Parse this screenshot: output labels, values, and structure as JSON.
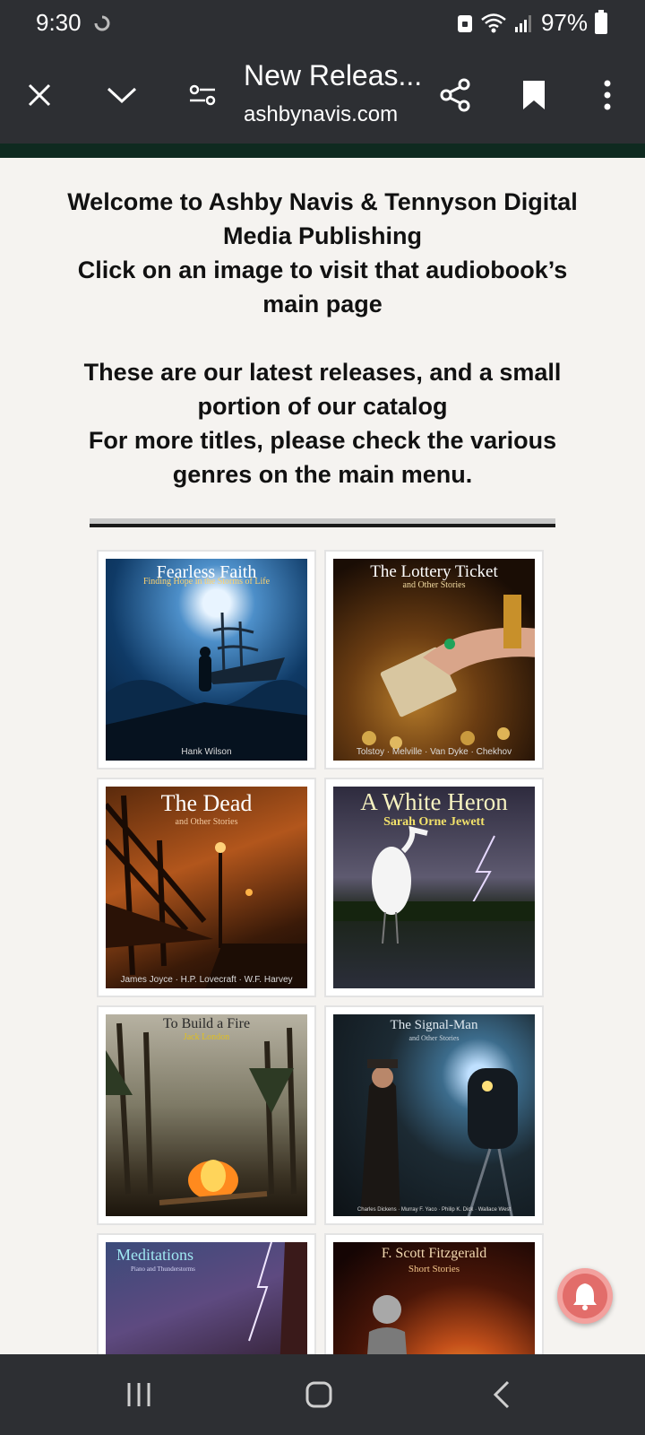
{
  "status": {
    "time": "9:30",
    "battery": "97%"
  },
  "toolbar": {
    "title": "New Releas...",
    "url": "ashbynavis.com"
  },
  "intro": {
    "line1": "Welcome to Ashby Navis & Tennyson Digital Media Publishing",
    "line2": "Click on an image to visit that audiobook’s main page",
    "line3": "These are our latest releases, and a small portion of our catalog",
    "line4": "For more titles, please check the various genres on the main menu."
  },
  "books": [
    {
      "title": "Fearless Faith",
      "subtitle": "Finding Hope in the Storms of Life",
      "author": "Hank Wilson"
    },
    {
      "title": "The Lottery Ticket",
      "subtitle": "and Other Stories",
      "author": "Tolstoy · Melville · Van Dyke · Chekhov"
    },
    {
      "title": "The Dead",
      "subtitle": "and Other Stories",
      "author": "James Joyce · H.P. Lovecraft · W.F. Harvey"
    },
    {
      "title": "A White Heron",
      "subtitle": "Sarah Orne Jewett",
      "author": ""
    },
    {
      "title": "To Build a Fire",
      "subtitle": "Jack London",
      "author": ""
    },
    {
      "title": "The Signal-Man",
      "subtitle": "and Other Stories",
      "author": "Charles Dickens · Murray F. Yaco · Philip K. Dick · Wallace West"
    },
    {
      "title": "Meditations",
      "subtitle": "Piano and Thunderstorms",
      "author": ""
    },
    {
      "title": "F. Scott Fitzgerald",
      "subtitle": "Short Stories",
      "author": ""
    }
  ],
  "colors": {
    "bar": "#2d2f33",
    "accent": "#0f2a20",
    "page": "#f5f3f0",
    "fab": "#e26d6a"
  },
  "icons": [
    "close-icon",
    "chevron-down-icon",
    "page-settings-icon",
    "share-icon",
    "bookmark-icon",
    "more-icon",
    "recents-icon",
    "home-icon",
    "back-icon",
    "notification-bell-icon"
  ]
}
